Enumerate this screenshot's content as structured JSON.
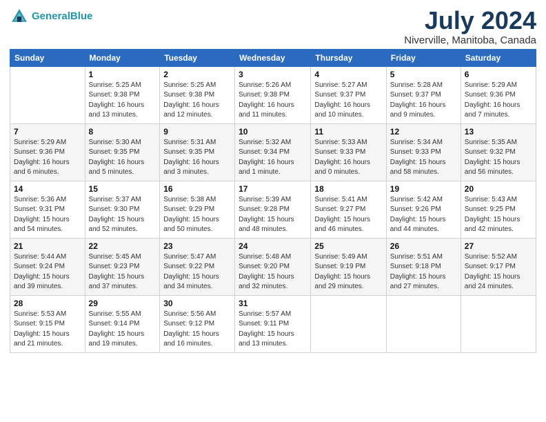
{
  "header": {
    "logo_text_general": "General",
    "logo_text_blue": "Blue",
    "month_year": "July 2024",
    "location": "Niverville, Manitoba, Canada"
  },
  "days_of_week": [
    "Sunday",
    "Monday",
    "Tuesday",
    "Wednesday",
    "Thursday",
    "Friday",
    "Saturday"
  ],
  "weeks": [
    [
      {
        "day": "",
        "info": ""
      },
      {
        "day": "1",
        "info": "Sunrise: 5:25 AM\nSunset: 9:38 PM\nDaylight: 16 hours\nand 13 minutes."
      },
      {
        "day": "2",
        "info": "Sunrise: 5:25 AM\nSunset: 9:38 PM\nDaylight: 16 hours\nand 12 minutes."
      },
      {
        "day": "3",
        "info": "Sunrise: 5:26 AM\nSunset: 9:38 PM\nDaylight: 16 hours\nand 11 minutes."
      },
      {
        "day": "4",
        "info": "Sunrise: 5:27 AM\nSunset: 9:37 PM\nDaylight: 16 hours\nand 10 minutes."
      },
      {
        "day": "5",
        "info": "Sunrise: 5:28 AM\nSunset: 9:37 PM\nDaylight: 16 hours\nand 9 minutes."
      },
      {
        "day": "6",
        "info": "Sunrise: 5:29 AM\nSunset: 9:36 PM\nDaylight: 16 hours\nand 7 minutes."
      }
    ],
    [
      {
        "day": "7",
        "info": "Sunrise: 5:29 AM\nSunset: 9:36 PM\nDaylight: 16 hours\nand 6 minutes."
      },
      {
        "day": "8",
        "info": "Sunrise: 5:30 AM\nSunset: 9:35 PM\nDaylight: 16 hours\nand 5 minutes."
      },
      {
        "day": "9",
        "info": "Sunrise: 5:31 AM\nSunset: 9:35 PM\nDaylight: 16 hours\nand 3 minutes."
      },
      {
        "day": "10",
        "info": "Sunrise: 5:32 AM\nSunset: 9:34 PM\nDaylight: 16 hours\nand 1 minute."
      },
      {
        "day": "11",
        "info": "Sunrise: 5:33 AM\nSunset: 9:33 PM\nDaylight: 16 hours\nand 0 minutes."
      },
      {
        "day": "12",
        "info": "Sunrise: 5:34 AM\nSunset: 9:33 PM\nDaylight: 15 hours\nand 58 minutes."
      },
      {
        "day": "13",
        "info": "Sunrise: 5:35 AM\nSunset: 9:32 PM\nDaylight: 15 hours\nand 56 minutes."
      }
    ],
    [
      {
        "day": "14",
        "info": "Sunrise: 5:36 AM\nSunset: 9:31 PM\nDaylight: 15 hours\nand 54 minutes."
      },
      {
        "day": "15",
        "info": "Sunrise: 5:37 AM\nSunset: 9:30 PM\nDaylight: 15 hours\nand 52 minutes."
      },
      {
        "day": "16",
        "info": "Sunrise: 5:38 AM\nSunset: 9:29 PM\nDaylight: 15 hours\nand 50 minutes."
      },
      {
        "day": "17",
        "info": "Sunrise: 5:39 AM\nSunset: 9:28 PM\nDaylight: 15 hours\nand 48 minutes."
      },
      {
        "day": "18",
        "info": "Sunrise: 5:41 AM\nSunset: 9:27 PM\nDaylight: 15 hours\nand 46 minutes."
      },
      {
        "day": "19",
        "info": "Sunrise: 5:42 AM\nSunset: 9:26 PM\nDaylight: 15 hours\nand 44 minutes."
      },
      {
        "day": "20",
        "info": "Sunrise: 5:43 AM\nSunset: 9:25 PM\nDaylight: 15 hours\nand 42 minutes."
      }
    ],
    [
      {
        "day": "21",
        "info": "Sunrise: 5:44 AM\nSunset: 9:24 PM\nDaylight: 15 hours\nand 39 minutes."
      },
      {
        "day": "22",
        "info": "Sunrise: 5:45 AM\nSunset: 9:23 PM\nDaylight: 15 hours\nand 37 minutes."
      },
      {
        "day": "23",
        "info": "Sunrise: 5:47 AM\nSunset: 9:22 PM\nDaylight: 15 hours\nand 34 minutes."
      },
      {
        "day": "24",
        "info": "Sunrise: 5:48 AM\nSunset: 9:20 PM\nDaylight: 15 hours\nand 32 minutes."
      },
      {
        "day": "25",
        "info": "Sunrise: 5:49 AM\nSunset: 9:19 PM\nDaylight: 15 hours\nand 29 minutes."
      },
      {
        "day": "26",
        "info": "Sunrise: 5:51 AM\nSunset: 9:18 PM\nDaylight: 15 hours\nand 27 minutes."
      },
      {
        "day": "27",
        "info": "Sunrise: 5:52 AM\nSunset: 9:17 PM\nDaylight: 15 hours\nand 24 minutes."
      }
    ],
    [
      {
        "day": "28",
        "info": "Sunrise: 5:53 AM\nSunset: 9:15 PM\nDaylight: 15 hours\nand 21 minutes."
      },
      {
        "day": "29",
        "info": "Sunrise: 5:55 AM\nSunset: 9:14 PM\nDaylight: 15 hours\nand 19 minutes."
      },
      {
        "day": "30",
        "info": "Sunrise: 5:56 AM\nSunset: 9:12 PM\nDaylight: 15 hours\nand 16 minutes."
      },
      {
        "day": "31",
        "info": "Sunrise: 5:57 AM\nSunset: 9:11 PM\nDaylight: 15 hours\nand 13 minutes."
      },
      {
        "day": "",
        "info": ""
      },
      {
        "day": "",
        "info": ""
      },
      {
        "day": "",
        "info": ""
      }
    ]
  ]
}
